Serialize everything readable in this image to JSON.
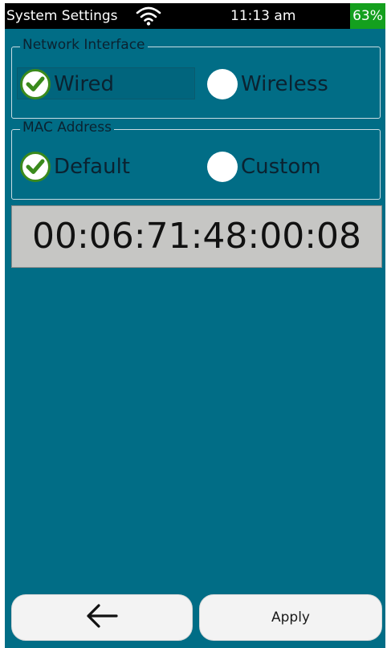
{
  "status_bar": {
    "title": "System Settings",
    "wifi_icon": "wifi-icon",
    "time": "11:13 am",
    "battery": "63%",
    "battery_color": "#14a01e"
  },
  "network_interface": {
    "legend": "Network Interface",
    "options": [
      {
        "label": "Wired",
        "selected": true
      },
      {
        "label": "Wireless",
        "selected": false
      }
    ]
  },
  "mac_address": {
    "legend": "MAC Address",
    "options": [
      {
        "label": "Default",
        "selected": true
      },
      {
        "label": "Custom",
        "selected": false
      }
    ],
    "value": "00:06:71:48:00:08"
  },
  "footer": {
    "back_icon": "arrow-left-icon",
    "apply_label": "Apply"
  },
  "colors": {
    "background": "#016d86",
    "check_green": "#3a8a1c",
    "mac_box": "#c6c6c4"
  }
}
